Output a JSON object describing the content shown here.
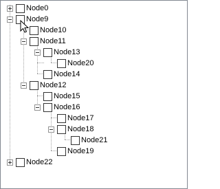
{
  "tree": {
    "nodes": [
      {
        "label": "Node0",
        "expander": "collapsed"
      },
      {
        "label": "Node9",
        "expander": "expanded"
      },
      {
        "label": "Node10",
        "expander": "none"
      },
      {
        "label": "Node11",
        "expander": "expanded"
      },
      {
        "label": "Node13",
        "expander": "expanded"
      },
      {
        "label": "Node20",
        "expander": "none"
      },
      {
        "label": "Node14",
        "expander": "none"
      },
      {
        "label": "Node12",
        "expander": "expanded"
      },
      {
        "label": "Node15",
        "expander": "none"
      },
      {
        "label": "Node16",
        "expander": "expanded"
      },
      {
        "label": "Node17",
        "expander": "none"
      },
      {
        "label": "Node18",
        "expander": "expanded"
      },
      {
        "label": "Node21",
        "expander": "none"
      },
      {
        "label": "Node19",
        "expander": "none"
      },
      {
        "label": "Node22",
        "expander": "collapsed"
      }
    ]
  },
  "colors": {
    "border": "#828790",
    "connector": "#a0a0a0"
  }
}
